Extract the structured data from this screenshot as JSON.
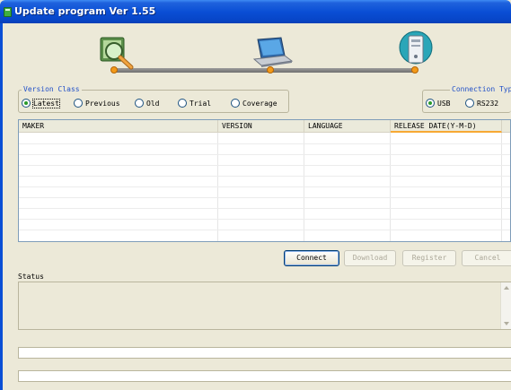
{
  "window": {
    "title": "Update program Ver 1.55"
  },
  "version_class": {
    "label": "Version Class",
    "options": [
      "Latest",
      "Previous",
      "Old",
      "Trial",
      "Coverage"
    ],
    "selected": "Latest"
  },
  "connection_type": {
    "label": "Connection Type",
    "options": [
      "USB",
      "RS232"
    ],
    "selected": "USB"
  },
  "list": {
    "columns": [
      "MAKER",
      "VERSION",
      "LANGUAGE",
      "RELEASE DATE(Y-M-D)"
    ],
    "rows": []
  },
  "buttons": {
    "connect": "Connect",
    "download": "Download",
    "register": "Register",
    "cancel": "Cancel"
  },
  "status": {
    "label": "Status",
    "text": ""
  },
  "icons": {
    "app": "app-icon",
    "search": "magnifier-icon",
    "laptop": "laptop-icon",
    "computer": "desktop-computer-icon"
  }
}
